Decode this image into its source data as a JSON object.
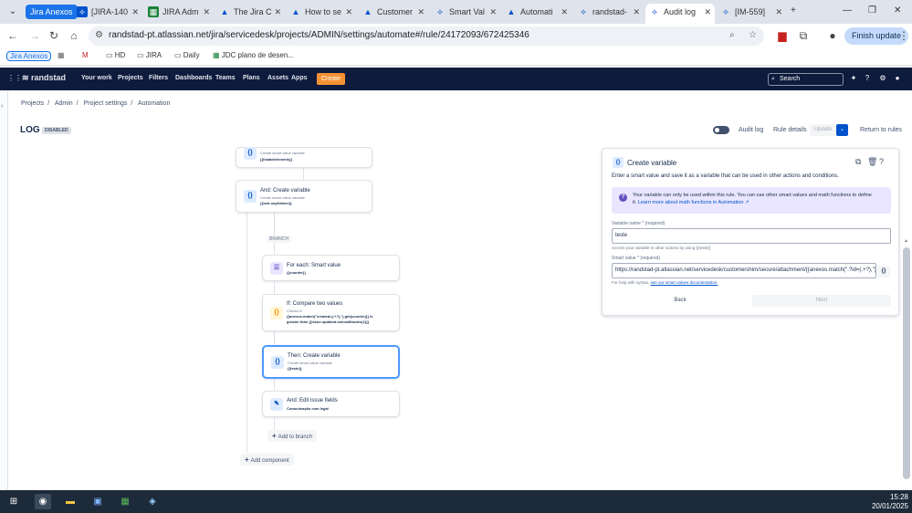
{
  "browser": {
    "tab_group": "Jira Anexos",
    "tabs": [
      {
        "label": "[JIRA-140",
        "icon": "jira-icon"
      },
      {
        "label": "JIRA Adm",
        "icon": "sheets-icon"
      },
      {
        "label": "The Jira C",
        "icon": "atlassian-icon"
      },
      {
        "label": "How to se",
        "icon": "atlassian-icon"
      },
      {
        "label": "Customer",
        "icon": "atlassian-icon"
      },
      {
        "label": "Smart Val",
        "icon": "jira-icon"
      },
      {
        "label": "Automati",
        "icon": "atlassian-icon"
      },
      {
        "label": "randstad-",
        "icon": "jira-icon"
      },
      {
        "label": "Audit log",
        "icon": "jira-icon",
        "active": true
      },
      {
        "label": "[IM-559]",
        "icon": "jira-icon"
      }
    ],
    "url": "randstad-pt.atlassian.net/jira/servicedesk/projects/ADMIN/settings/automate#/rule/24172093/672425346",
    "finish_update": "Finish update",
    "bookmarks": {
      "group": "Jira Anexos",
      "items": [
        "HD",
        "JIRA",
        "Daily",
        "JDC plano de desen..."
      ]
    }
  },
  "jira_nav": {
    "brand": "randstad",
    "items": [
      "Your work",
      "Projects",
      "Filters",
      "Dashboards",
      "Teams",
      "Plans",
      "Assets",
      "Apps"
    ],
    "create": "Create",
    "search_placeholder": "Search"
  },
  "breadcrumbs": [
    "Projects",
    "Admin",
    "Project settings",
    "Automation"
  ],
  "header": {
    "title": "LOG",
    "status": "DISABLED",
    "audit_log": "Audit log",
    "rule_details": "Rule details",
    "update": "Update",
    "return": "Return to rules"
  },
  "rule_nodes": {
    "n1": {
      "sub": "Create smart value variable",
      "val": "{{listaIdelements}}"
    },
    "n2": {
      "title": "And: Create variable",
      "sub": "Create smart value variable",
      "val": "{{varLoopValues}}"
    },
    "branch": "BRANCH",
    "n3": {
      "title": "For each: Smart value",
      "val": "{{counter}}"
    },
    "n4": {
      "title": "If: Compare two values",
      "sub": "Checks if:",
      "val1": "{{anexos.match(\"created=(.+?),\").get(counter)}} is",
      "val2": "greater than {{issue.updated.minusMinutes(1)}}"
    },
    "n5": {
      "title": "Then: Create variable",
      "sub": "Create smart value variable",
      "val": "{{teste}}"
    },
    "n6": {
      "title": "And: Edit issue fields",
      "val": "Comunicação com legal"
    },
    "add_to_branch": "Add to branch",
    "add_component": "Add component"
  },
  "panel": {
    "title": "Create variable",
    "description": "Enter a smart value and save it as a variable that can be used in other actions and conditions.",
    "info_line1": "Your variable can only be used within this rule. You can use other smart values and math functions to define",
    "info_line2_prefix": "it. ",
    "info_link": "Learn more about math functions in Automation ↗",
    "var_name_label": "Variable name * (required)",
    "var_name_value": "teste",
    "var_name_help": "Access your variable in other actions by using {{teste}}",
    "smart_label": "Smart value * (required)",
    "smart_value": "https://randstad-pt.atlassian.net/servicedesk/customershim/secure/attachment/{{anexos.match(\".?id=(.+?),\").get",
    "smart_help_prefix": "For help with syntax, ",
    "smart_help_link": "see our smart values documentation.",
    "back": "Back",
    "next": "Next"
  },
  "taskbar": {
    "time": "15:28",
    "date": "20/01/2025"
  }
}
